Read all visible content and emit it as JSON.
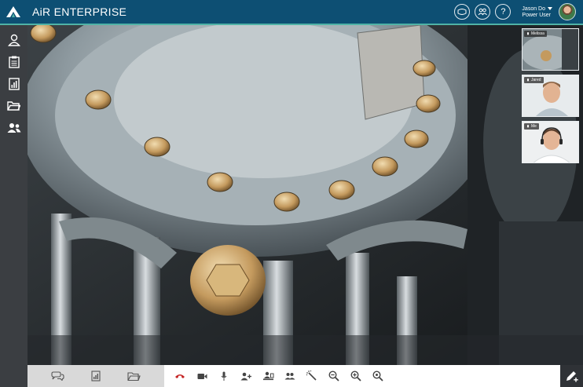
{
  "header": {
    "app_title": "AiR ENTERPRISE",
    "user_name": "Jason Do",
    "user_role": "Power User",
    "help_label": "?"
  },
  "sidebar": {
    "items": [
      {
        "icon": "user-icon"
      },
      {
        "icon": "clipboard-icon"
      },
      {
        "icon": "report-icon"
      },
      {
        "icon": "folder-icon"
      },
      {
        "icon": "contacts-icon"
      }
    ]
  },
  "participants": [
    {
      "name": "Melissa"
    },
    {
      "name": "Jared"
    },
    {
      "name": "Me"
    }
  ],
  "colors": {
    "header": "#0d4f73",
    "accent": "#4fb3a6",
    "sidebar": "#3b3e42",
    "end_call": "#c62828"
  }
}
